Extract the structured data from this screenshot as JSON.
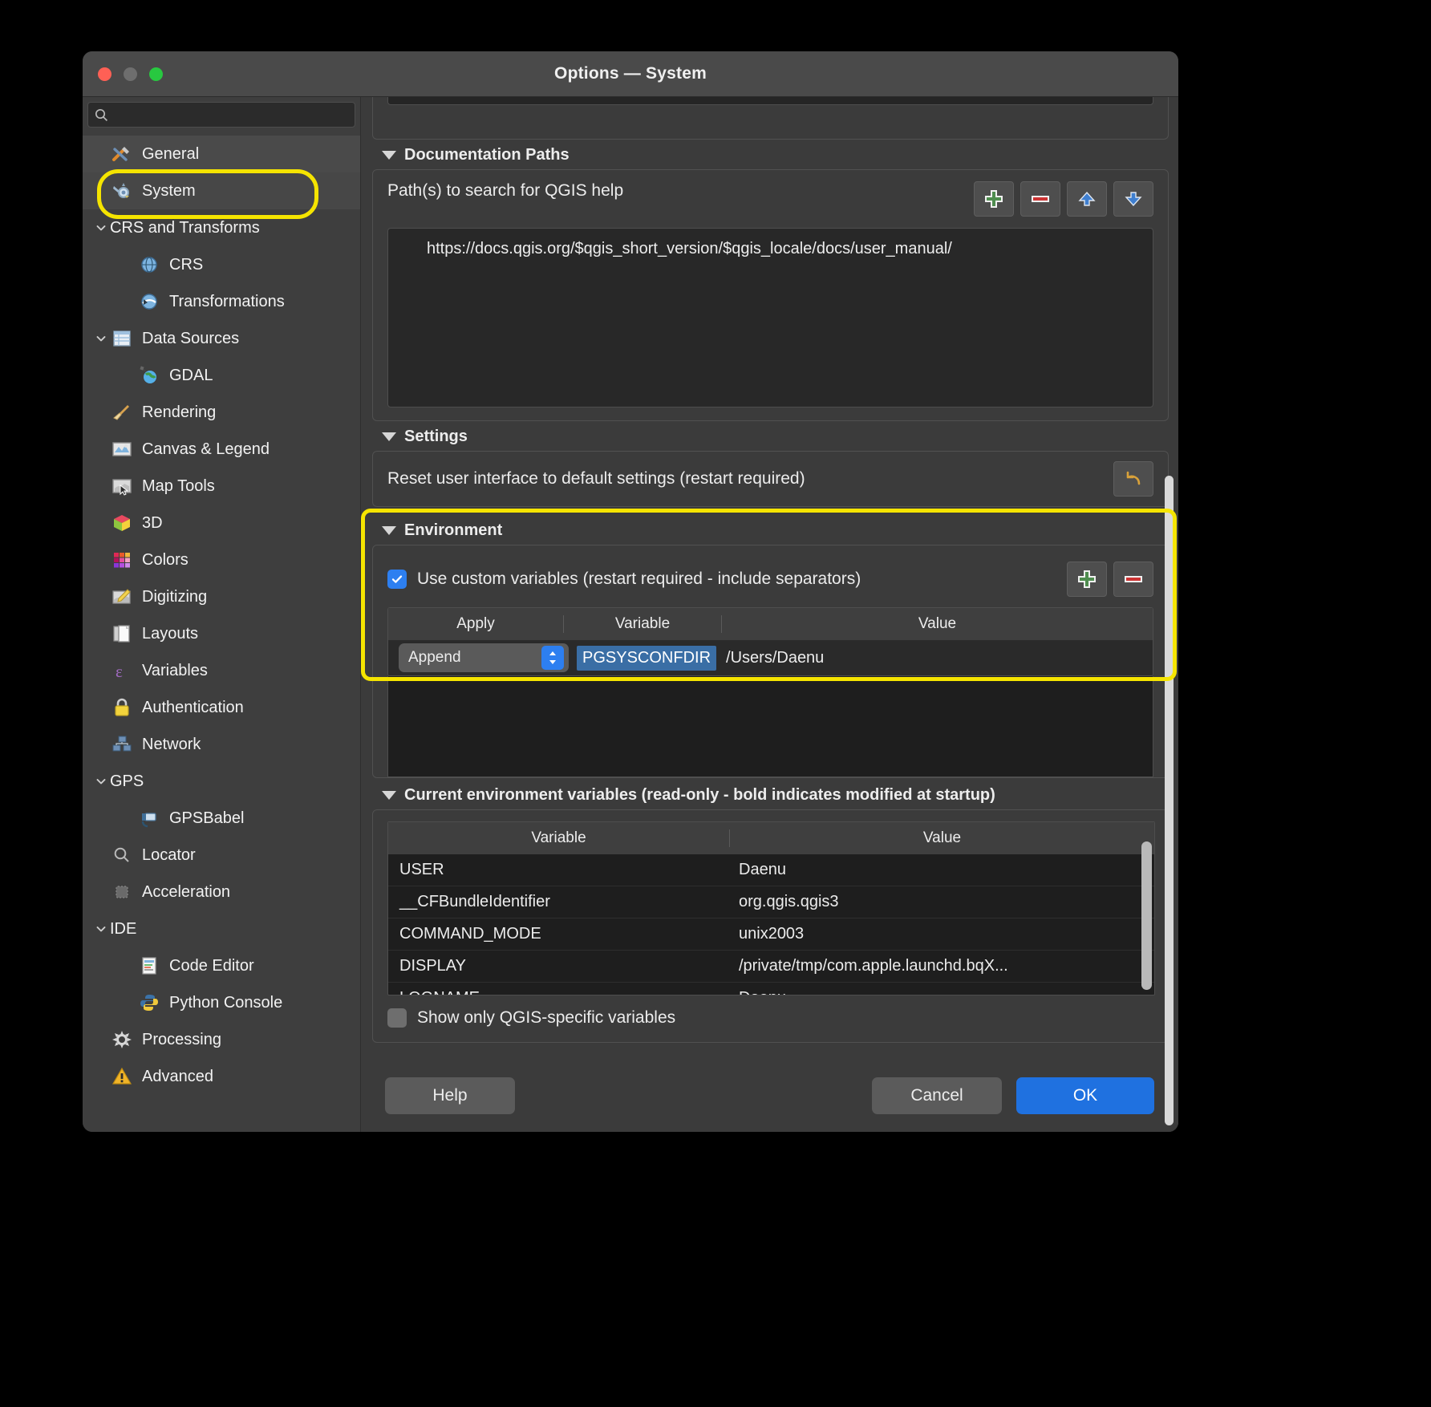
{
  "window": {
    "title": "Options — System"
  },
  "sidebar": {
    "search_placeholder": "",
    "items": [
      {
        "label": "General",
        "icon": "tools-icon",
        "level": 0,
        "expander": false,
        "state": "hovered"
      },
      {
        "label": "System",
        "icon": "system-gear-icon",
        "level": 0,
        "expander": false,
        "state": "selected"
      },
      {
        "label": "CRS and Transforms",
        "icon": "none",
        "level": 0,
        "expander": true,
        "state": "normal"
      },
      {
        "label": "CRS",
        "icon": "globe-grid-icon",
        "level": 1,
        "expander": false,
        "state": "normal"
      },
      {
        "label": "Transformations",
        "icon": "globe-transform-icon",
        "level": 1,
        "expander": false,
        "state": "normal"
      },
      {
        "label": "Data Sources",
        "icon": "table-icon",
        "level": 0,
        "expander": true,
        "state": "normal"
      },
      {
        "label": "GDAL",
        "icon": "earth-satellite-icon",
        "level": 1,
        "expander": false,
        "state": "normal"
      },
      {
        "label": "Rendering",
        "icon": "broom-icon",
        "level": 0,
        "expander": false,
        "state": "normal"
      },
      {
        "label": "Canvas & Legend",
        "icon": "canvas-icon",
        "level": 0,
        "expander": false,
        "state": "normal"
      },
      {
        "label": "Map Tools",
        "icon": "map-cursor-icon",
        "level": 0,
        "expander": false,
        "state": "normal"
      },
      {
        "label": "3D",
        "icon": "cube-icon",
        "level": 0,
        "expander": false,
        "state": "normal"
      },
      {
        "label": "Colors",
        "icon": "color-swatches-icon",
        "level": 0,
        "expander": false,
        "state": "normal"
      },
      {
        "label": "Digitizing",
        "icon": "pencil-map-icon",
        "level": 0,
        "expander": false,
        "state": "normal"
      },
      {
        "label": "Layouts",
        "icon": "page-layout-icon",
        "level": 0,
        "expander": false,
        "state": "normal"
      },
      {
        "label": "Variables",
        "icon": "epsilon-icon",
        "level": 0,
        "expander": false,
        "state": "normal"
      },
      {
        "label": "Authentication",
        "icon": "lock-icon",
        "level": 0,
        "expander": false,
        "state": "normal"
      },
      {
        "label": "Network",
        "icon": "network-icon",
        "level": 0,
        "expander": false,
        "state": "normal"
      },
      {
        "label": "GPS",
        "icon": "none",
        "level": 0,
        "expander": true,
        "state": "normal"
      },
      {
        "label": "GPSBabel",
        "icon": "gps-device-icon",
        "level": 1,
        "expander": false,
        "state": "normal"
      },
      {
        "label": "Locator",
        "icon": "search-icon",
        "level": 0,
        "expander": false,
        "state": "normal"
      },
      {
        "label": "Acceleration",
        "icon": "chip-icon",
        "level": 0,
        "expander": false,
        "state": "normal"
      },
      {
        "label": "IDE",
        "icon": "none",
        "level": 0,
        "expander": true,
        "state": "normal"
      },
      {
        "label": "Code Editor",
        "icon": "code-doc-icon",
        "level": 1,
        "expander": false,
        "state": "normal"
      },
      {
        "label": "Python Console",
        "icon": "python-icon",
        "level": 1,
        "expander": false,
        "state": "normal"
      },
      {
        "label": "Processing",
        "icon": "gear-star-icon",
        "level": 0,
        "expander": false,
        "state": "normal"
      },
      {
        "label": "Advanced",
        "icon": "warning-icon",
        "level": 0,
        "expander": false,
        "state": "normal"
      }
    ]
  },
  "main": {
    "documentation_paths": {
      "title": "Documentation Paths",
      "label": "Path(s) to search for QGIS help",
      "buttons": [
        {
          "name": "add-path-button",
          "icon": "plus-icon"
        },
        {
          "name": "remove-path-button",
          "icon": "minus-icon"
        },
        {
          "name": "move-up-button",
          "icon": "arrow-up-icon"
        },
        {
          "name": "move-down-button",
          "icon": "arrow-down-icon"
        }
      ],
      "paths": [
        "https://docs.qgis.org/$qgis_short_version/$qgis_locale/docs/user_manual/"
      ]
    },
    "settings": {
      "title": "Settings",
      "reset_label": "Reset user interface to default settings (restart required)",
      "reset_button_icon": "undo-arrow-icon"
    },
    "environment": {
      "title": "Environment",
      "use_custom_label": "Use custom variables (restart required - include separators)",
      "use_custom_checked": true,
      "buttons": [
        {
          "name": "add-variable-button",
          "icon": "plus-icon"
        },
        {
          "name": "remove-variable-button",
          "icon": "minus-icon"
        }
      ],
      "columns": [
        "Apply",
        "Variable",
        "Value"
      ],
      "rows": [
        {
          "apply": "Append",
          "variable": "PGSYSCONFDIR",
          "value": "/Users/Daenu"
        }
      ]
    },
    "current_env": {
      "title": "Current environment variables (read-only - bold indicates modified at startup)",
      "columns": [
        "Variable",
        "Value"
      ],
      "rows": [
        {
          "variable": "USER",
          "value": "Daenu"
        },
        {
          "variable": "__CFBundleIdentifier",
          "value": "org.qgis.qgis3"
        },
        {
          "variable": "COMMAND_MODE",
          "value": "unix2003"
        },
        {
          "variable": "DISPLAY",
          "value": "/private/tmp/com.apple.launchd.bqX..."
        },
        {
          "variable": "LOGNAME",
          "value": "Daenu"
        }
      ],
      "show_only_label": "Show only QGIS-specific variables",
      "show_only_checked": false
    }
  },
  "footer": {
    "help_label": "Help",
    "cancel_label": "Cancel",
    "ok_label": "OK"
  },
  "colors": {
    "highlight": "#f5e400",
    "accent_blue": "#1f71e0",
    "selection_blue": "#3a6ea5"
  }
}
